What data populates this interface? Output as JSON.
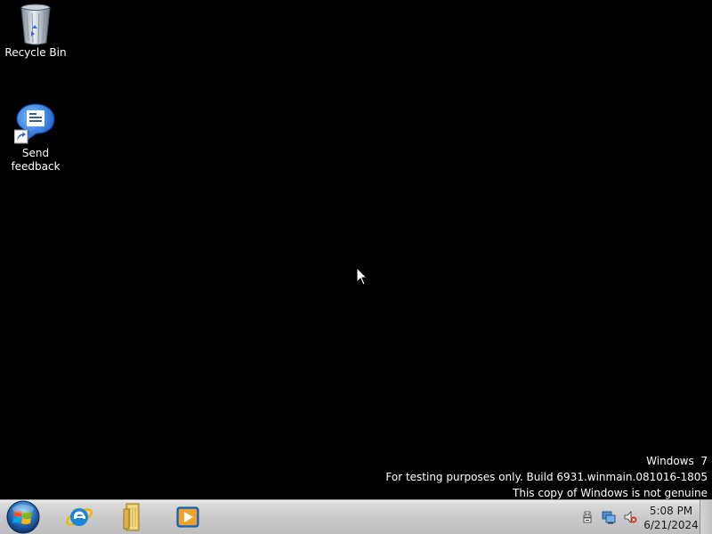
{
  "desktop": {
    "icons": [
      {
        "label": "Recycle Bin",
        "icon": "recycle-bin-icon"
      },
      {
        "label": "Send feedback",
        "icon": "send-feedback-icon"
      }
    ]
  },
  "watermark": {
    "line1": "Windows  7",
    "line2": "For testing purposes only. Build 6931.winmain.081016-1805",
    "line3": "This copy of Windows is not genuine"
  },
  "taskbar": {
    "start": {
      "icon": "windows-start-orb-icon"
    },
    "pinned": [
      {
        "icon": "internet-explorer-icon"
      },
      {
        "icon": "windows-explorer-icon"
      },
      {
        "icon": "windows-media-player-icon"
      }
    ],
    "tray": {
      "icons": [
        "action-center-icon",
        "network-icon",
        "volume-muted-icon"
      ],
      "time": "5:08 PM",
      "date": "6/21/2024"
    }
  },
  "colors": {
    "desktop_background": "#000000",
    "taskbar": "#c9c9c9",
    "text_on_desktop": "#ffffff"
  }
}
